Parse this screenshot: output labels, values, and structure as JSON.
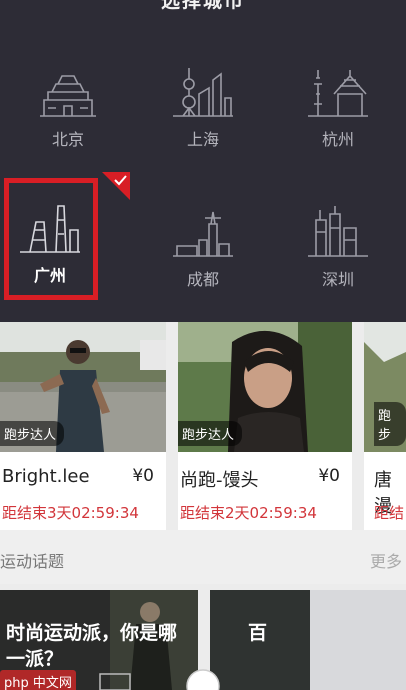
{
  "picker": {
    "title": "选择城市",
    "cities": [
      {
        "label": "北京"
      },
      {
        "label": "上海"
      },
      {
        "label": "杭州"
      },
      {
        "label": "广州"
      },
      {
        "label": "成都"
      },
      {
        "label": "深圳"
      }
    ],
    "selected": "广州"
  },
  "cards": [
    {
      "badge": "跑步达人",
      "name": "Bright.lee",
      "price": "¥0",
      "countdown": "距结束3天02:59:34"
    },
    {
      "badge": "跑步达人",
      "name": "尚跑-馒头",
      "price": "¥0",
      "countdown": "距结束2天02:59:34"
    },
    {
      "badge": "跑步",
      "name": "唐漫",
      "price": "",
      "countdown": "距结"
    }
  ],
  "topics": {
    "title": "运动话题",
    "more": "更多",
    "items": [
      {
        "text": "时尚运动派，你是哪一派？"
      },
      {
        "text": "百"
      }
    ]
  },
  "watermark": "php 中文网",
  "colors": {
    "accent": "#d81e25",
    "countdown": "#d2353a",
    "picker_bg": "#2d2c36"
  }
}
